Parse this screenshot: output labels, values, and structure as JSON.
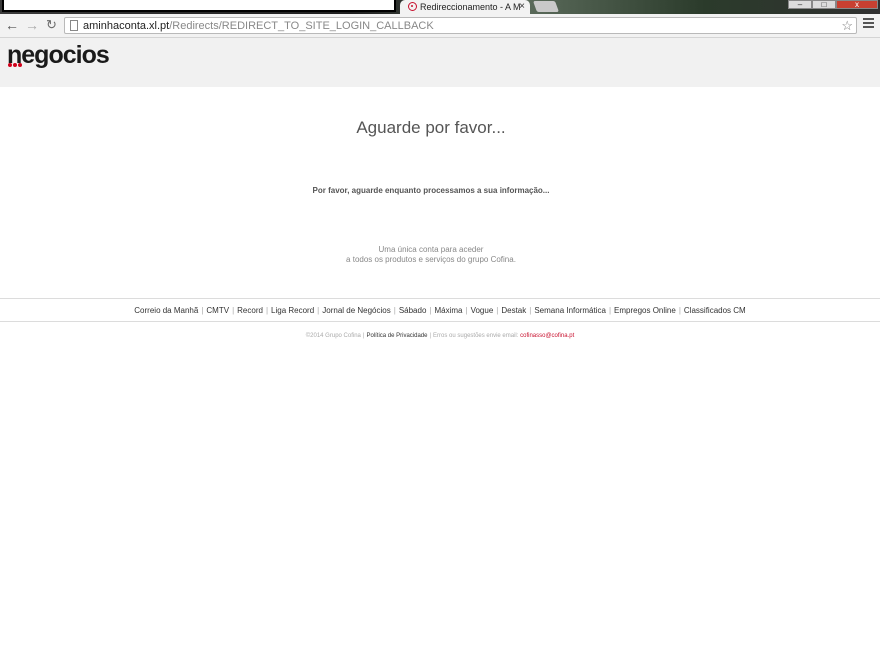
{
  "browser": {
    "tab_title": "Redireccionamento - A M",
    "url_host": "aminhaconta.xl.pt",
    "url_path": "/Redirects/REDIRECT_TO_SITE_LOGIN_CALLBACK",
    "close_glyph": "×"
  },
  "site": {
    "logo_text": "negocios",
    "heading": "Aguarde por favor...",
    "message": "Por favor, aguarde enquanto processamos a sua informação...",
    "tagline_line1": "Uma única conta para aceder",
    "tagline_line2": "a todos os produtos e serviços do grupo Cofina."
  },
  "footer": {
    "links": [
      "Correio da Manhã",
      "CMTV",
      "Record",
      "Liga Record",
      "Jornal de Negócios",
      "Sábado",
      "Máxima",
      "Vogue",
      "Destak",
      "Semana Informática",
      "Empregos Online",
      "Classificados CM"
    ],
    "copyright": "©2014 Grupo Cofina",
    "privacy": "Política de Privacidade",
    "suggestions": "Erros ou sugestões envie email:",
    "email": "cofinasso@cofina.pt"
  },
  "colors": {
    "brand_red": "#c8102e",
    "header_bg": "#f1f1f1"
  }
}
